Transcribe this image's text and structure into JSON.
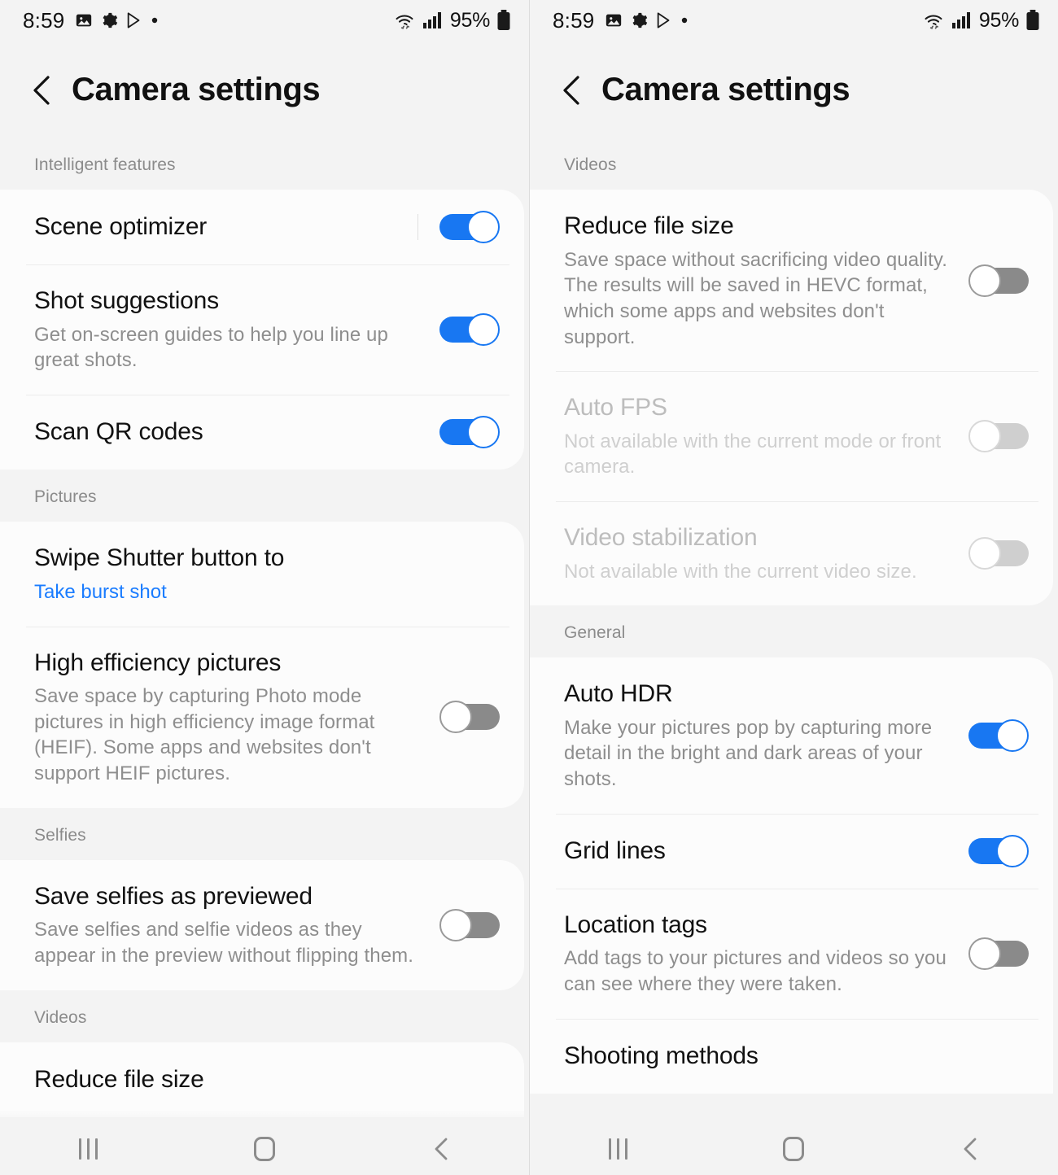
{
  "status_bar": {
    "time": "8:59",
    "battery_percent": "95%",
    "left_icons": [
      "image-icon",
      "gear-icon",
      "play-store-icon",
      "dot-icon"
    ],
    "right_icons": [
      "wifi-icon",
      "cellular-signal-icon",
      "battery-icon"
    ]
  },
  "header": {
    "title": "Camera settings",
    "back_icon": "back-chevron-icon"
  },
  "nav_bar": {
    "recents": "recents-button",
    "home": "home-button",
    "back": "back-button"
  },
  "left_screen": {
    "sections": [
      {
        "label": "Intelligent features",
        "rows": [
          {
            "title": "Scene optimizer",
            "sub": "",
            "toggle": "on",
            "divider_before_toggle": true
          },
          {
            "title": "Shot suggestions",
            "sub": "Get on-screen guides to help you line up great shots.",
            "toggle": "on"
          },
          {
            "title": "Scan QR codes",
            "sub": "",
            "toggle": "on"
          }
        ]
      },
      {
        "label": "Pictures",
        "rows": [
          {
            "title": "Swipe Shutter button to",
            "value": "Take burst shot",
            "toggle": "none"
          },
          {
            "title": "High efficiency pictures",
            "sub": "Save space by capturing Photo mode pictures in high efficiency image format (HEIF). Some apps and websites don't support HEIF pictures.",
            "toggle": "off"
          }
        ]
      },
      {
        "label": "Selfies",
        "rows": [
          {
            "title": "Save selfies as previewed",
            "sub": "Save selfies and selfie videos as they appear in the preview without flipping them.",
            "toggle": "off"
          }
        ]
      },
      {
        "label": "Videos",
        "rows": [
          {
            "title": "Reduce file size",
            "sub": "",
            "toggle": "none"
          }
        ]
      }
    ]
  },
  "right_screen": {
    "sections": [
      {
        "label": "Videos",
        "rows": [
          {
            "title": "Reduce file size",
            "sub": "Save space without sacrificing video quality. The results will be saved in HEVC format, which some apps and websites don't support.",
            "toggle": "off"
          },
          {
            "title": "Auto FPS",
            "sub": "Not available with the current mode or front camera.",
            "toggle": "off",
            "disabled": true
          },
          {
            "title": "Video stabilization",
            "sub": "Not available with the current video size.",
            "toggle": "off",
            "disabled": true
          }
        ]
      },
      {
        "label": "General",
        "rows": [
          {
            "title": "Auto HDR",
            "sub": "Make your pictures pop by capturing more detail in the bright and dark areas of your shots.",
            "toggle": "on"
          },
          {
            "title": "Grid lines",
            "sub": "",
            "toggle": "on"
          },
          {
            "title": "Location tags",
            "sub": "Add tags to your pictures and videos so you can see where they were taken.",
            "toggle": "off"
          },
          {
            "title": "Shooting methods",
            "sub": "",
            "toggle": "none"
          }
        ]
      }
    ]
  },
  "colors": {
    "accent_blue": "#1877f2",
    "link_blue": "#1a7cff",
    "page_bg": "#f3f3f3",
    "card_bg": "#fcfcfc",
    "toggle_off_gray": "#8a8a8a"
  }
}
